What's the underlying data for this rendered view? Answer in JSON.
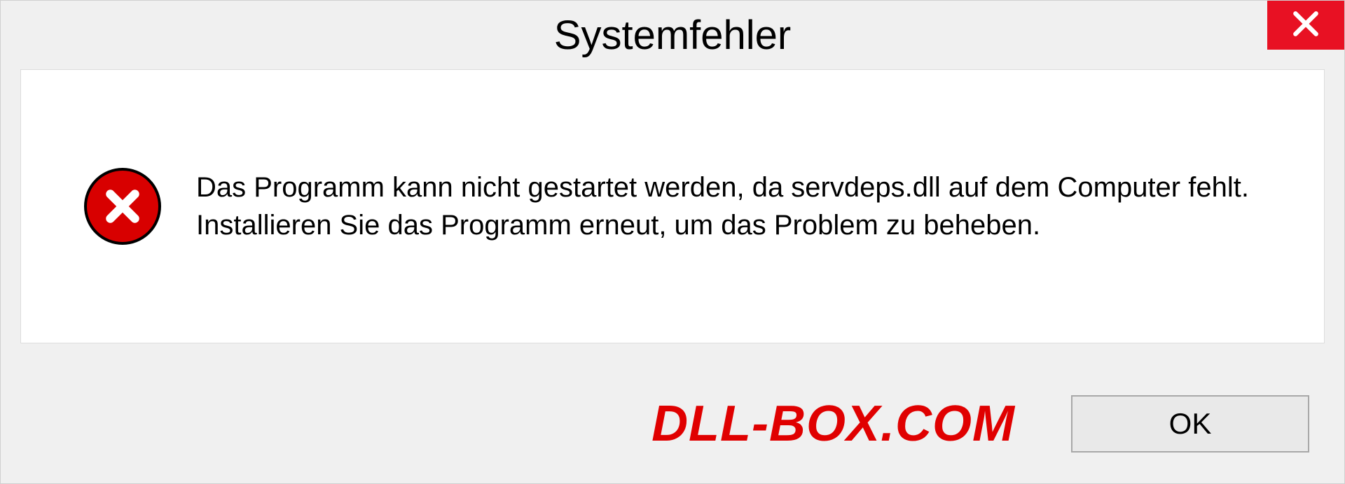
{
  "dialog": {
    "title": "Systemfehler",
    "message": "Das Programm kann nicht gestartet werden, da servdeps.dll auf dem Computer fehlt. Installieren Sie das Programm erneut, um das Problem zu beheben.",
    "ok_label": "OK"
  },
  "watermark": "DLL-BOX.COM"
}
